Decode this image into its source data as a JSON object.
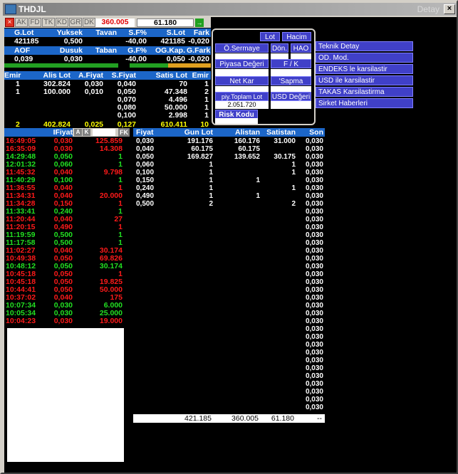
{
  "window": {
    "title": "THDJL",
    "detail_label": "Detay",
    "close": "×"
  },
  "toolbar": {
    "close": "×",
    "tabs": [
      "AK",
      "FD",
      "TK",
      "KD",
      "GR",
      "DK"
    ],
    "value1": "360.005",
    "value2": "61.180",
    "go": "→"
  },
  "summary": {
    "row1_headers": [
      "G.Lot",
      "Yuksek",
      "Tavan",
      "S.F%",
      "S.Lot",
      "Fark"
    ],
    "row1_values": [
      "421185",
      "0,500",
      "",
      "-40,00",
      "421185",
      "-0,020"
    ],
    "row2_headers": [
      "AOF",
      "Dusuk",
      "Taban",
      "G.F%",
      "OG.Kap.",
      "G.Fark"
    ],
    "row2_values": [
      "0,039",
      "0,030",
      "",
      "-40,00",
      "0,050",
      "-0,020"
    ]
  },
  "depth": {
    "headers": [
      "Emir",
      "Alis Lot",
      "A.Fiyat",
      "S.Fiyat",
      "Satis Lot",
      "Emir"
    ],
    "rows": [
      [
        "1",
        "302.824",
        "0,030",
        "0,040",
        "70",
        "1"
      ],
      [
        "1",
        "100.000",
        "0,010",
        "0,050",
        "47.348",
        "2"
      ],
      [
        "",
        "",
        "",
        "0,070",
        "4.496",
        "1"
      ],
      [
        "",
        "",
        "",
        "0,080",
        "50.000",
        "1"
      ],
      [
        "",
        "",
        "",
        "0,100",
        "2.998",
        "1"
      ]
    ],
    "totals": [
      "2",
      "402.824",
      "0,025",
      "0,127",
      "610.411",
      "10"
    ]
  },
  "popup": {
    "lot": "Lot",
    "hacim": "Hacim",
    "osermaye": "Ö.Sermaye",
    "don": "Dön.",
    "hao": "HAO",
    "piyasa": "Piyasa Değeri",
    "fk": "F / K",
    "netkar": "Net Kar",
    "sapma": "'Sapma",
    "piytoplam": "piy.Toplam Lot",
    "usd": "USD Değeri",
    "piytoplam_value": "2.051.720",
    "risk": "Risk Kodu"
  },
  "right_menu": [
    "Teknik Detay",
    "OD. Mod.",
    "ENDEKS le karsilastir",
    "USD ile karsilastir",
    "TAKAS Karsilastirma",
    "Sirket Haberleri"
  ],
  "trades": {
    "header_fiyat": "IFiyat",
    "header_a": "A",
    "header_k": "K",
    "header_fk": "FK",
    "rows": [
      {
        "time": "16:49:05",
        "price": "0,030",
        "lot": "125.859",
        "c": "r"
      },
      {
        "time": "16:35:09",
        "price": "0,030",
        "lot": "14.308",
        "c": "r"
      },
      {
        "time": "14:29:48",
        "price": "0,050",
        "lot": "1",
        "c": "g"
      },
      {
        "time": "12:01:32",
        "price": "0,060",
        "lot": "1",
        "c": "g"
      },
      {
        "time": "11:45:32",
        "price": "0,040",
        "lot": "9.798",
        "c": "r"
      },
      {
        "time": "11:40:29",
        "price": "0,100",
        "lot": "1",
        "c": "g"
      },
      {
        "time": "11:36:55",
        "price": "0,040",
        "lot": "1",
        "c": "r"
      },
      {
        "time": "11:34:31",
        "price": "0,040",
        "lot": "20.000",
        "c": "r"
      },
      {
        "time": "11:34:28",
        "price": "0,150",
        "lot": "1",
        "c": "r"
      },
      {
        "time": "11:33:41",
        "price": "0,240",
        "lot": "1",
        "c": "g"
      },
      {
        "time": "11:20:44",
        "price": "0,040",
        "lot": "27",
        "c": "r"
      },
      {
        "time": "11:20:15",
        "price": "0,490",
        "lot": "1",
        "c": "r"
      },
      {
        "time": "11:19:59",
        "price": "0,500",
        "lot": "1",
        "c": "g"
      },
      {
        "time": "11:17:58",
        "price": "0,500",
        "lot": "1",
        "c": "g"
      },
      {
        "time": "11:02:27",
        "price": "0,040",
        "lot": "30.174",
        "c": "r"
      },
      {
        "time": "10:49:38",
        "price": "0,050",
        "lot": "69.826",
        "c": "r"
      },
      {
        "time": "10:48:12",
        "price": "0,050",
        "lot": "30.174",
        "c": "g"
      },
      {
        "time": "10:45:18",
        "price": "0,050",
        "lot": "1",
        "c": "r"
      },
      {
        "time": "10:45:18",
        "price": "0,050",
        "lot": "19.825",
        "c": "r"
      },
      {
        "time": "10:44:41",
        "price": "0,050",
        "lot": "50.000",
        "c": "r"
      },
      {
        "time": "10:37:02",
        "price": "0,040",
        "lot": "175",
        "c": "r"
      },
      {
        "time": "10:07:34",
        "price": "0,030",
        "lot": "6.000",
        "c": "g"
      },
      {
        "time": "10:05:34",
        "price": "0,030",
        "lot": "25.000",
        "c": "g"
      },
      {
        "time": "10:04:23",
        "price": "0,030",
        "lot": "19.000",
        "c": "r"
      }
    ]
  },
  "pricetable": {
    "headers": [
      "Fiyat",
      "Gun Lot",
      "Alistan",
      "Satistan",
      "Son"
    ],
    "rows": [
      [
        "0,030",
        "191.176",
        "160.176",
        "31.000"
      ],
      [
        "0,040",
        "60.175",
        "60.175",
        ""
      ],
      [
        "0,050",
        "169.827",
        "139.652",
        "30.175"
      ],
      [
        "0,060",
        "1",
        "",
        "1"
      ],
      [
        "0,100",
        "1",
        "",
        "1"
      ],
      [
        "0,150",
        "1",
        "1",
        ""
      ],
      [
        "0,240",
        "1",
        "",
        "1"
      ],
      [
        "0,490",
        "1",
        "1",
        ""
      ],
      [
        "0,500",
        "2",
        "",
        "2"
      ]
    ],
    "son_value": "0,030",
    "son_count": 35,
    "totals": [
      "421.185",
      "360.005",
      "61.180",
      "--"
    ]
  },
  "colors": {
    "header_blue": "#1c66c8",
    "popup_blue": "#4040c8",
    "buy_green": "#22e022",
    "sell_red": "#ff1a1a",
    "bg": "#000000"
  }
}
